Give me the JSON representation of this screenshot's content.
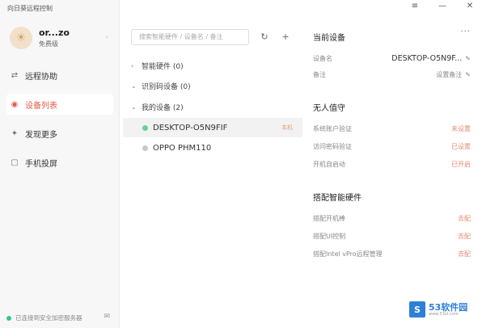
{
  "app": {
    "title": "向日葵远程控制"
  },
  "user": {
    "name": "or...zo",
    "tier": "免费级"
  },
  "nav": [
    {
      "label": "远程协助",
      "icon": "remote-assist-icon"
    },
    {
      "label": "设备列表",
      "icon": "device-list-icon",
      "active": true
    },
    {
      "label": "发现更多",
      "icon": "discover-icon"
    },
    {
      "label": "手机投屏",
      "icon": "phone-cast-icon"
    }
  ],
  "status": {
    "text": "已连接到安全加密服务器"
  },
  "search": {
    "placeholder": "搜索智能硬件 / 设备名 / 备注"
  },
  "groups": {
    "smart_hw": "智能硬件 (0)",
    "identified": "识别码设备 (0)",
    "mine": "我的设备 (2)"
  },
  "devices": [
    {
      "name": "DESKTOP-O5N9FIF",
      "tag": "本机",
      "color": "#6ccf9f"
    },
    {
      "name": "OPPO PHM110",
      "tag": "",
      "color": "#c8c8c8"
    }
  ],
  "current_device": {
    "title": "当前设备",
    "name_label": "设备名",
    "name_value": "DESKTOP-O5N9F...",
    "note_label": "备注",
    "note_value": "设置备注"
  },
  "unattended": {
    "title": "无人值守",
    "rows": [
      {
        "label": "系统账户验证",
        "value": "未设置"
      },
      {
        "label": "访问密码验证",
        "value": "已设置"
      },
      {
        "label": "开机自启动",
        "value": "已开启"
      }
    ]
  },
  "smart_hardware": {
    "title": "搭配智能硬件",
    "rows": [
      {
        "label": "搭配开机棒",
        "value": "去配"
      },
      {
        "label": "搭配UI控制",
        "value": "去配"
      },
      {
        "label": "搭配Intel vPro远程管理",
        "value": "去配"
      }
    ]
  },
  "watermark": {
    "brand": "53软件园",
    "site": "www.53xt.com"
  }
}
